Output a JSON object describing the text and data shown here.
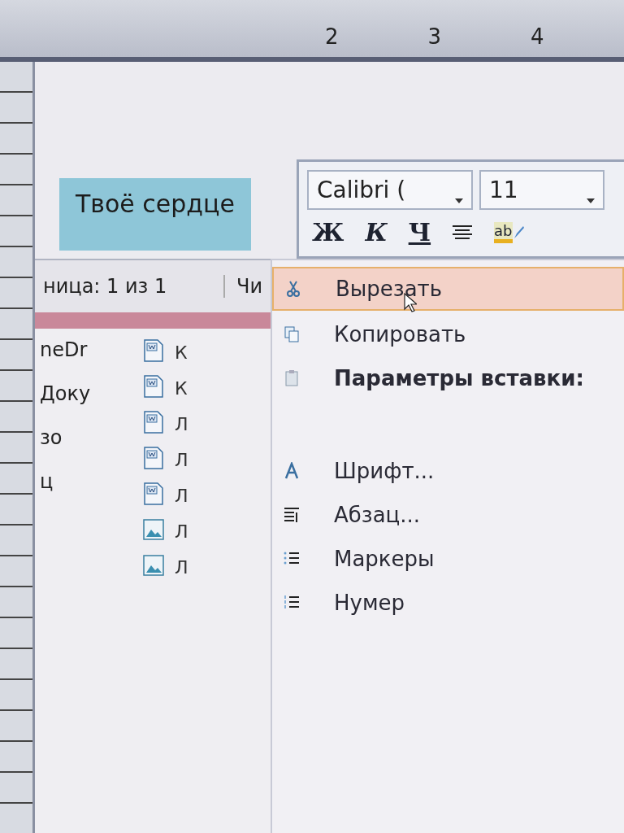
{
  "ruler": {
    "numbers": [
      "2",
      "3",
      "4"
    ]
  },
  "document": {
    "selected_text": "Твоё сердце"
  },
  "mini_toolbar": {
    "font": "Calibri (",
    "size": "11",
    "buttons": [
      {
        "kind": "bold",
        "label": "Ж"
      },
      {
        "kind": "italic",
        "label": "К"
      },
      {
        "kind": "underline",
        "label": "Ч"
      },
      {
        "kind": "align"
      },
      {
        "kind": "highlight",
        "label": "ab"
      }
    ]
  },
  "status_bar": {
    "page": "ница: 1 из 1",
    "words": "Чи"
  },
  "file_panel": {
    "items": [
      "neDr",
      "Доку",
      "зо",
      "ц"
    ],
    "files": [
      {
        "kind": "doc",
        "name": "К"
      },
      {
        "kind": "doc",
        "name": "К"
      },
      {
        "kind": "doc",
        "name": "Л"
      },
      {
        "kind": "doc",
        "name": "Л"
      },
      {
        "kind": "doc",
        "name": "Л"
      },
      {
        "kind": "image",
        "name": "Л"
      },
      {
        "kind": "image",
        "name": "Л"
      }
    ]
  },
  "context_menu": {
    "items": [
      {
        "kind": "cut",
        "label": "Вырезать",
        "selected": true
      },
      {
        "kind": "copy",
        "label": "Копировать",
        "selected": false
      },
      {
        "kind": "paste",
        "label": "Параметры вставки:",
        "selected": false
      },
      {
        "kind": "spacer"
      },
      {
        "kind": "font",
        "label": "Шрифт...",
        "selected": false
      },
      {
        "kind": "paragraph",
        "label": "Абзац...",
        "selected": false
      },
      {
        "kind": "bullets",
        "label": "Маркеры",
        "selected": false
      },
      {
        "kind": "numbering",
        "label": "Нумер",
        "selected": false
      }
    ]
  }
}
